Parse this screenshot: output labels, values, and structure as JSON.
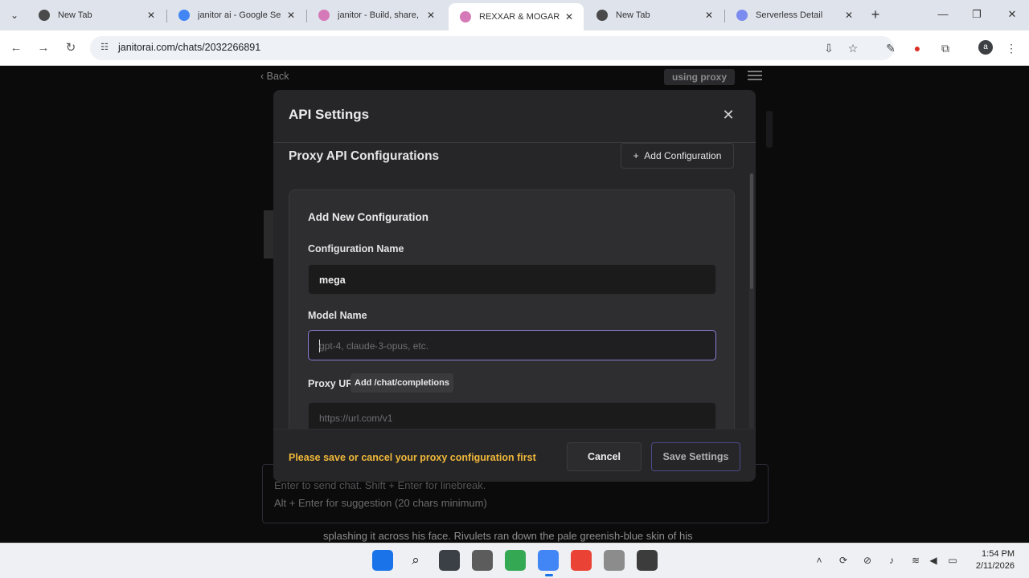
{
  "browser": {
    "tabs": [
      {
        "title": "New Tab",
        "favicon": "chrome-icon",
        "color": "#4a4a4a"
      },
      {
        "title": "janitor ai - Google Se",
        "favicon": "google-icon",
        "color": "#4285f4"
      },
      {
        "title": "janitor - Build, share,",
        "favicon": "janitor-icon",
        "color": "#d679b8"
      },
      {
        "title": "REXXAR & MOGAR |",
        "favicon": "janitor-icon",
        "color": "#d679b8"
      },
      {
        "title": "New Tab",
        "favicon": "chrome-icon",
        "color": "#4a4a4a"
      },
      {
        "title": "Serverless Detail",
        "favicon": "serverless-icon",
        "color": "#7a8cf0"
      }
    ],
    "tab_close_glyph": "✕",
    "new_tab_glyph": "+",
    "url": "janitorai.com/chats/2032266891",
    "profile_initial": "a"
  },
  "page": {
    "back_label": "Back",
    "proxy_badge": "using proxy",
    "chat_placeholder_line1": "Enter to send chat. Shift + Enter for linebreak.",
    "chat_placeholder_line2": "Alt + Enter for suggestion (20 chars minimum)",
    "story_text": "splashing it across his face. Rivulets ran down the pale greenish-blue skin of his"
  },
  "modal": {
    "title": "API Settings",
    "close_glyph": "✕",
    "section_title": "Proxy API Configurations",
    "add_config_label": "Add Configuration",
    "card_title": "Add New Configuration",
    "config_name_label": "Configuration Name",
    "config_name_value": "mega",
    "model_name_label": "Model Name",
    "model_name_placeholder": "gpt-4, claude-3-opus, etc.",
    "proxy_url_label": "Proxy URL",
    "add_completions_label": "Add /chat/completions",
    "proxy_url_placeholder": "https://url.com/v1",
    "warning_text": "Please save or cancel your proxy configuration first",
    "cancel_label": "Cancel",
    "save_label": "Save Settings"
  },
  "taskbar": {
    "time": "1:54 PM",
    "date": "2/11/2026"
  },
  "colors": {
    "accent_focus": "#8a7fd6",
    "warning": "#f0b83a",
    "modal_bg": "#262628"
  }
}
